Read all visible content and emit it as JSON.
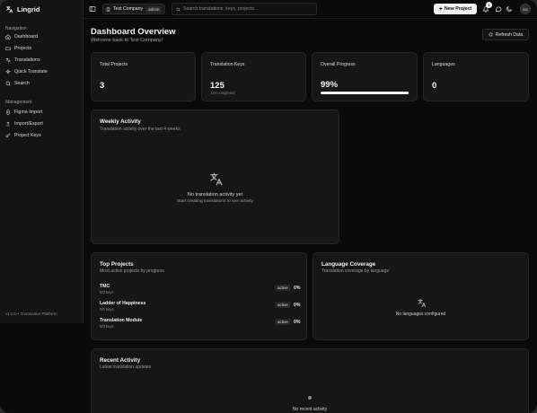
{
  "app": {
    "name": "Lingrid",
    "version": "v1.0.0 • Translation Platform"
  },
  "sidebar": {
    "navigation_title": "Navigation",
    "navigation": [
      {
        "label": "Dashboard",
        "icon": "home-icon"
      },
      {
        "label": "Projects",
        "icon": "folder-icon"
      },
      {
        "label": "Translations",
        "icon": "languages-icon"
      },
      {
        "label": "Quick Translate",
        "icon": "sparkles-icon"
      },
      {
        "label": "Search",
        "icon": "search-icon"
      }
    ],
    "management_title": "Management",
    "management": [
      {
        "label": "Figma Import",
        "icon": "figma-icon"
      },
      {
        "label": "Import/Export",
        "icon": "upload-icon"
      },
      {
        "label": "Project Keys",
        "icon": "key-icon"
      }
    ]
  },
  "topbar": {
    "company": "Test Company",
    "role": "admin",
    "search_placeholder": "Search translations, keys, projects...",
    "new_project": "New Project",
    "notification_count": "1",
    "avatar_initials": "NG"
  },
  "header": {
    "title": "Dashboard Overview",
    "subtitle": "Welcome back to Test Company!",
    "refresh": "Refresh Data"
  },
  "stats": {
    "total_projects": {
      "label": "Total Projects",
      "value": "3"
    },
    "translation_keys": {
      "label": "Translation Keys",
      "value": "125",
      "sub": "124 completed"
    },
    "overall_progress": {
      "label": "Overall Progress",
      "value": "99%",
      "progress_fraction": 0.99
    },
    "languages": {
      "label": "Languages",
      "value": "0"
    }
  },
  "weekly_activity": {
    "title": "Weekly Activity",
    "subtitle": "Translation activity over the last 4 weeks",
    "empty_title": "No translation activity yet",
    "empty_sub": "Start creating translations to see activity"
  },
  "top_projects": {
    "title": "Top Projects",
    "subtitle": "Most active projects by progress",
    "items": [
      {
        "name": "TMC",
        "keys": "0/0 keys",
        "status": "active",
        "percent": "0%"
      },
      {
        "name": "Ladder of Happiness",
        "keys": "0/0 keys",
        "status": "active",
        "percent": "0%"
      },
      {
        "name": "Translation Module",
        "keys": "0/0 keys",
        "status": "active",
        "percent": "0%"
      }
    ]
  },
  "language_coverage": {
    "title": "Language Coverage",
    "subtitle": "Translation coverage by language",
    "empty": "No languages configured"
  },
  "recent_activity": {
    "title": "Recent Activity",
    "subtitle": "Latest translation updates",
    "empty": "No recent activity"
  }
}
